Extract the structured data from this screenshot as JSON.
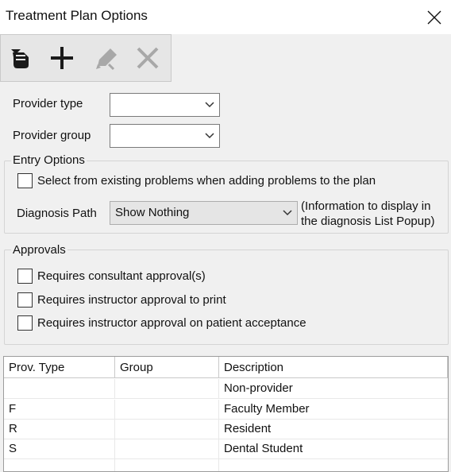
{
  "window": {
    "title": "Treatment Plan Options"
  },
  "toolbar": {
    "buttons": [
      {
        "name": "copy",
        "icon": "copy-layers-icon"
      },
      {
        "name": "add",
        "icon": "plus-icon"
      },
      {
        "name": "edit",
        "icon": "pencil-icon"
      },
      {
        "name": "delete",
        "icon": "x-icon"
      }
    ]
  },
  "form": {
    "provider_type_label": "Provider type",
    "provider_type_value": "",
    "provider_group_label": "Provider group",
    "provider_group_value": ""
  },
  "entry_options": {
    "title": "Entry Options",
    "select_existing_label": "Select from existing problems when adding problems to the plan",
    "select_existing_checked": false,
    "diagnosis_path_label": "Diagnosis Path",
    "diagnosis_path_value": "Show Nothing",
    "diagnosis_note_line1": "(Information to display in",
    "diagnosis_note_line2": "the diagnosis List Popup)"
  },
  "approvals": {
    "title": "Approvals",
    "items": [
      {
        "label": "Requires consultant approval(s)",
        "checked": false
      },
      {
        "label": "Requires instructor approval to print",
        "checked": false
      },
      {
        "label": "Requires instructor approval on patient acceptance",
        "checked": false
      }
    ]
  },
  "table": {
    "columns": [
      "Prov. Type",
      "Group",
      "Description"
    ],
    "rows": [
      [
        "",
        "",
        "Non-provider"
      ],
      [
        "F",
        "",
        "Faculty Member"
      ],
      [
        "R",
        "",
        "Resident"
      ],
      [
        "S",
        "",
        "Dental Student"
      ]
    ]
  },
  "colors": {
    "toolbar_icon": "#1a1a1a",
    "toolbar_icon_disabled": "#a8a8a8",
    "window_bg": "#f0f0f0"
  }
}
